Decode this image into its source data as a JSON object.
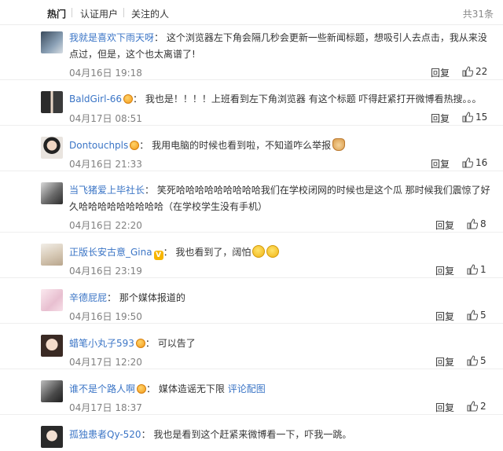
{
  "tabs": [
    {
      "label": "热门"
    },
    {
      "label": "认证用户"
    },
    {
      "label": "关注的人"
    }
  ],
  "total": "共31条",
  "comments": [
    {
      "user": "我就是喜欢下雨天呀",
      "badge": "",
      "text": "这个浏览器左下角会隔几秒会更新一些新闻标题，想吸引人去点击，我从来没点过，但是，这个也太离谱了!",
      "date": "04月16日 19:18",
      "reply": "回复",
      "likes": "22"
    },
    {
      "user": "BaldGirl-66",
      "badge": "orange",
      "text": "我也是！！！！上班看到左下角浏览器 有这个标题 吓得赶紧打开微博看热搜。。。",
      "date": "04月17日 08:51",
      "reply": "回复",
      "likes": "15"
    },
    {
      "user": "Dontouchpls",
      "badge": "orange",
      "text": "我用电脑的时候也看到啦，不知道咋么举报",
      "date": "04月16日 21:33",
      "reply": "回复",
      "likes": "16"
    },
    {
      "user": "当飞猪爱上毕社长",
      "badge": "",
      "text": "笑死哈哈哈哈哈哈哈哈哈我们在学校闭网的时候也是这个瓜 那时候我们震惊了好久哈哈哈哈哈哈哈哈哈（在学校学生没有手机）",
      "date": "04月16日 22:20",
      "reply": "回复",
      "likes": "8"
    },
    {
      "user": "正版长安古意_Gina",
      "badge": "v",
      "text": "我也看到了，阔怕",
      "date": "04月16日 23:19",
      "reply": "回复",
      "likes": "1"
    },
    {
      "user": "辛德屁屁",
      "badge": "",
      "text": "那个媒体报道的",
      "date": "04月16日 19:50",
      "reply": "回复",
      "likes": "5"
    },
    {
      "user": "蜡笔小丸子593",
      "badge": "orange",
      "text": "可以告了",
      "date": "04月17日 12:20",
      "reply": "回复",
      "likes": "5"
    },
    {
      "user": "谁不是个路人啊",
      "badge": "orange",
      "text": "媒体造谣无下限",
      "link": "评论配图",
      "date": "04月17日 18:37",
      "reply": "回复",
      "likes": "2"
    },
    {
      "user": "孤独患者Qy-520",
      "badge": "",
      "text": "我也是看到这个赶紧来微博看一下，吓我一跳。",
      "date": "",
      "reply": "",
      "likes": ""
    }
  ]
}
